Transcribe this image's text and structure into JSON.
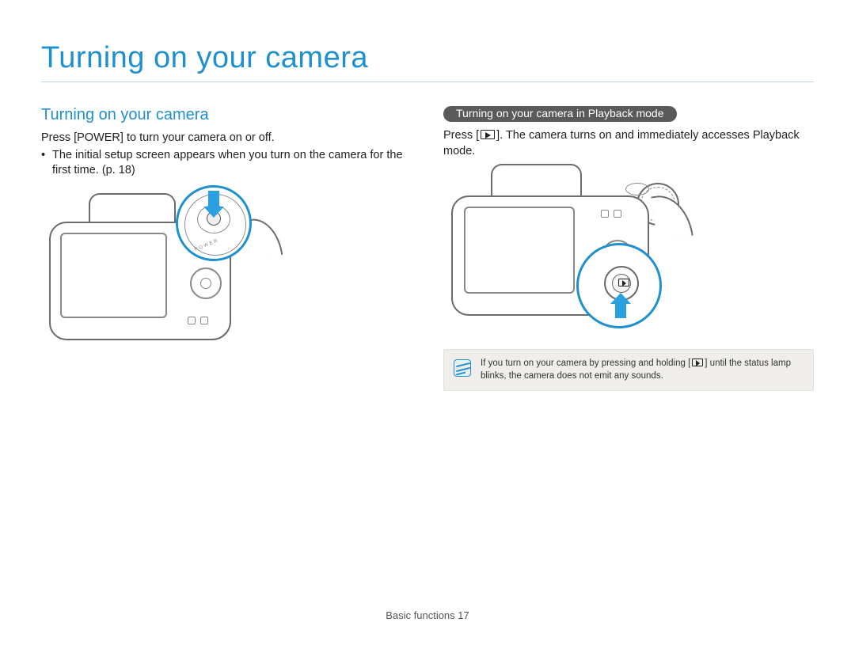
{
  "page": {
    "title": "Turning on your camera",
    "footer_section": "Basic functions",
    "footer_page": "17"
  },
  "left": {
    "heading": "Turning on your camera",
    "p1": "Press [POWER] to turn your camera on or off.",
    "bullet": "•",
    "p2": "The initial setup screen appears when you turn on the camera for the first time. (p. 18)",
    "power_label": "POWER"
  },
  "right": {
    "pill": "Turning on your camera in Playback mode",
    "p1a": "Press [",
    "p1b": "]. The camera turns on and immediately accesses Playback mode.",
    "note_a": "If you turn on your camera by pressing and holding [",
    "note_b": "] until the status lamp blinks, the camera does not emit any sounds."
  }
}
